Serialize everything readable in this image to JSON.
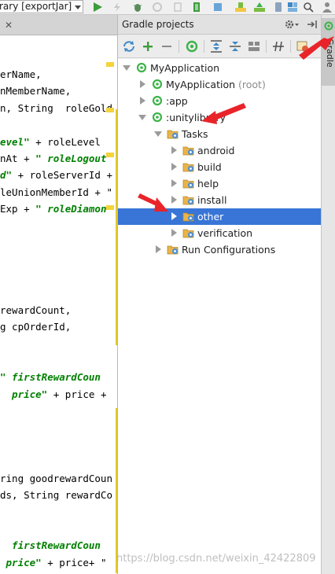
{
  "toolbar": {
    "run_config": "rary [exportJar]"
  },
  "editor": {
    "lines": [
      {
        "text": "erName,",
        "kind": "plain"
      },
      {
        "text": "nMemberName,",
        "kind": "plain"
      },
      {
        "text": "n, String  roleGold",
        "kind": "plain"
      },
      {
        "text": "",
        "kind": "plain"
      },
      {
        "text": "evel\"",
        "kind": "kw",
        "rest": " + roleLevel"
      },
      {
        "text": "nAt + ",
        "kind": "plain",
        "kwrest": "\" roleLogout"
      },
      {
        "text": "d\"",
        "kind": "kw",
        "rest": " + roleServerId +"
      },
      {
        "text": "leUnionMemberId + \"",
        "kind": "plain"
      },
      {
        "text": "Exp + ",
        "kind": "plain",
        "kwrest": "\" roleDiamon"
      },
      {
        "text": "",
        "kind": "plain"
      },
      {
        "text": "",
        "kind": "plain"
      },
      {
        "text": "",
        "kind": "plain"
      },
      {
        "text": "",
        "kind": "plain"
      },
      {
        "text": "",
        "kind": "plain"
      },
      {
        "text": "rewardCount,",
        "kind": "plain"
      },
      {
        "text": "g cpOrderId,",
        "kind": "plain"
      },
      {
        "text": "",
        "kind": "plain"
      },
      {
        "text": "",
        "kind": "plain"
      },
      {
        "text": "\" firstRewardCoun",
        "kind": "kw"
      },
      {
        "text": "  price\"",
        "kind": "kw",
        "rest": " + price +"
      },
      {
        "text": "",
        "kind": "plain"
      },
      {
        "text": "",
        "kind": "plain"
      },
      {
        "text": "",
        "kind": "plain"
      },
      {
        "text": "",
        "kind": "plain"
      },
      {
        "text": "ring goodrewardCoun",
        "kind": "plain"
      },
      {
        "text": "ds, String rewardCo",
        "kind": "plain"
      },
      {
        "text": "",
        "kind": "plain"
      },
      {
        "text": "",
        "kind": "plain"
      },
      {
        "text": "  firstRewardCoun",
        "kind": "kw"
      },
      {
        "text": " price\"",
        "kind": "kw",
        "rest": " + price+ \""
      }
    ]
  },
  "gradle": {
    "title": "Gradle projects",
    "side_label": "Gradle",
    "tree": [
      {
        "label": "MyApplication",
        "suffix": "",
        "level": 0,
        "toggle": "expanded",
        "icon": "gradle-project-icon"
      },
      {
        "label": "MyApplication",
        "suffix": " (root)",
        "level": 1,
        "toggle": "collapsed",
        "icon": "gradle-project-icon"
      },
      {
        "label": ":app",
        "suffix": "",
        "level": 1,
        "toggle": "collapsed",
        "icon": "gradle-project-icon"
      },
      {
        "label": ":unitylibrary",
        "suffix": "",
        "level": 1,
        "toggle": "expanded",
        "icon": "gradle-project-icon"
      },
      {
        "label": "Tasks",
        "suffix": "",
        "level": 2,
        "toggle": "expanded",
        "icon": "task-folder-icon"
      },
      {
        "label": "android",
        "suffix": "",
        "level": 3,
        "toggle": "collapsed",
        "icon": "task-folder-icon"
      },
      {
        "label": "build",
        "suffix": "",
        "level": 3,
        "toggle": "collapsed",
        "icon": "task-folder-icon"
      },
      {
        "label": "help",
        "suffix": "",
        "level": 3,
        "toggle": "collapsed",
        "icon": "task-folder-icon"
      },
      {
        "label": "install",
        "suffix": "",
        "level": 3,
        "toggle": "collapsed",
        "icon": "task-folder-icon"
      },
      {
        "label": "other",
        "suffix": "",
        "level": 3,
        "toggle": "collapsed",
        "icon": "task-folder-icon",
        "selected": true
      },
      {
        "label": "verification",
        "suffix": "",
        "level": 3,
        "toggle": "collapsed",
        "icon": "task-folder-icon"
      },
      {
        "label": "Run Configurations",
        "suffix": "",
        "level": 2,
        "toggle": "collapsed",
        "icon": "task-folder-icon"
      }
    ]
  },
  "watermark": "https://blog.csdn.net/weixin_42422809",
  "colors": {
    "selection": "#3875d7",
    "gradle_green": "#3db34a",
    "annotation_red": "#e8242a",
    "keyword_green": "#008000"
  }
}
